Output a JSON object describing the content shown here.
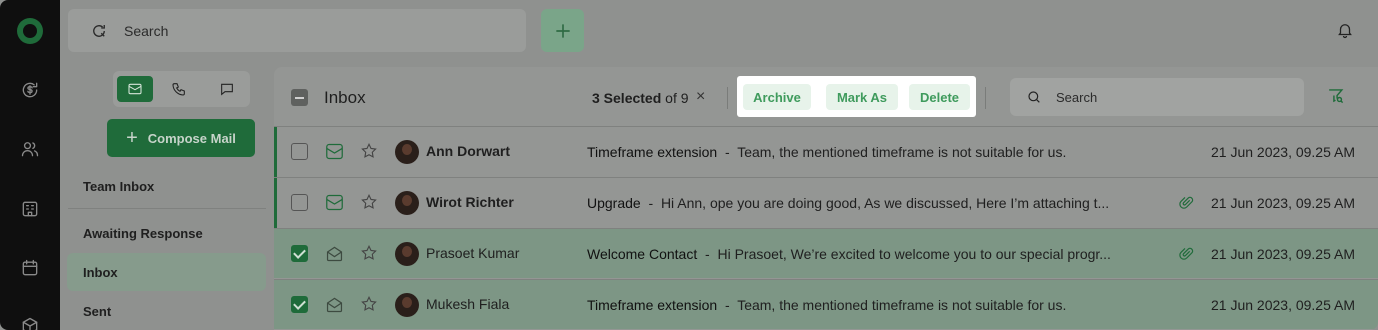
{
  "topbar": {
    "search_placeholder": "Search"
  },
  "sidebar": {
    "compose_label": "Compose Mail",
    "items": [
      {
        "label": "Team Inbox"
      },
      {
        "label": "Awaiting Response"
      },
      {
        "label": "Inbox"
      },
      {
        "label": "Sent"
      }
    ]
  },
  "mail": {
    "title": "Inbox",
    "selected_count": "3 Selected",
    "of_total": "of 9",
    "clear_symbol": "×",
    "actions": {
      "archive": "Archive",
      "mark_as": "Mark As",
      "delete": "Delete"
    },
    "search_placeholder": "Search",
    "rows": [
      {
        "sender": "Ann Dorwart",
        "subject": "Timeframe extension",
        "separator": "-",
        "preview": "Team, the mentioned timeframe is not suitable for us.",
        "date": "21 Jun 2023, 09.25 AM",
        "checked": false,
        "attachment": false
      },
      {
        "sender": "Wirot Richter",
        "subject": "Upgrade",
        "separator": "-",
        "preview": "Hi Ann, ope you are doing good, As we discussed, Here I’m attaching t...",
        "date": "21 Jun 2023, 09.25 AM",
        "checked": false,
        "attachment": true
      },
      {
        "sender": "Prasoet Kumar",
        "subject": "Welcome Contact",
        "separator": "-",
        "preview": "Hi Prasoet, We’re excited to welcome you to our special progr...",
        "date": "21 Jun 2023, 09.25 AM",
        "checked": true,
        "attachment": true
      },
      {
        "sender": "Mukesh Fiala",
        "subject": "Timeframe extension",
        "separator": "-",
        "preview": "Team, the mentioned timeframe is not suitable for us.",
        "date": "21 Jun 2023, 09.25 AM",
        "checked": true,
        "attachment": false
      }
    ]
  },
  "colors": {
    "brand": "#1f6b3a",
    "accent_text": "#3f9b5d",
    "overlay": "#8f918f"
  },
  "icons": [
    "logo-icon",
    "dollar-refresh-icon",
    "users-icon",
    "building-icon",
    "calendar-icon",
    "box-icon",
    "search-icon",
    "plus-icon",
    "bell-icon",
    "mail-icon",
    "phone-icon",
    "chat-icon",
    "filter-icon",
    "star-icon",
    "attachment-icon"
  ]
}
